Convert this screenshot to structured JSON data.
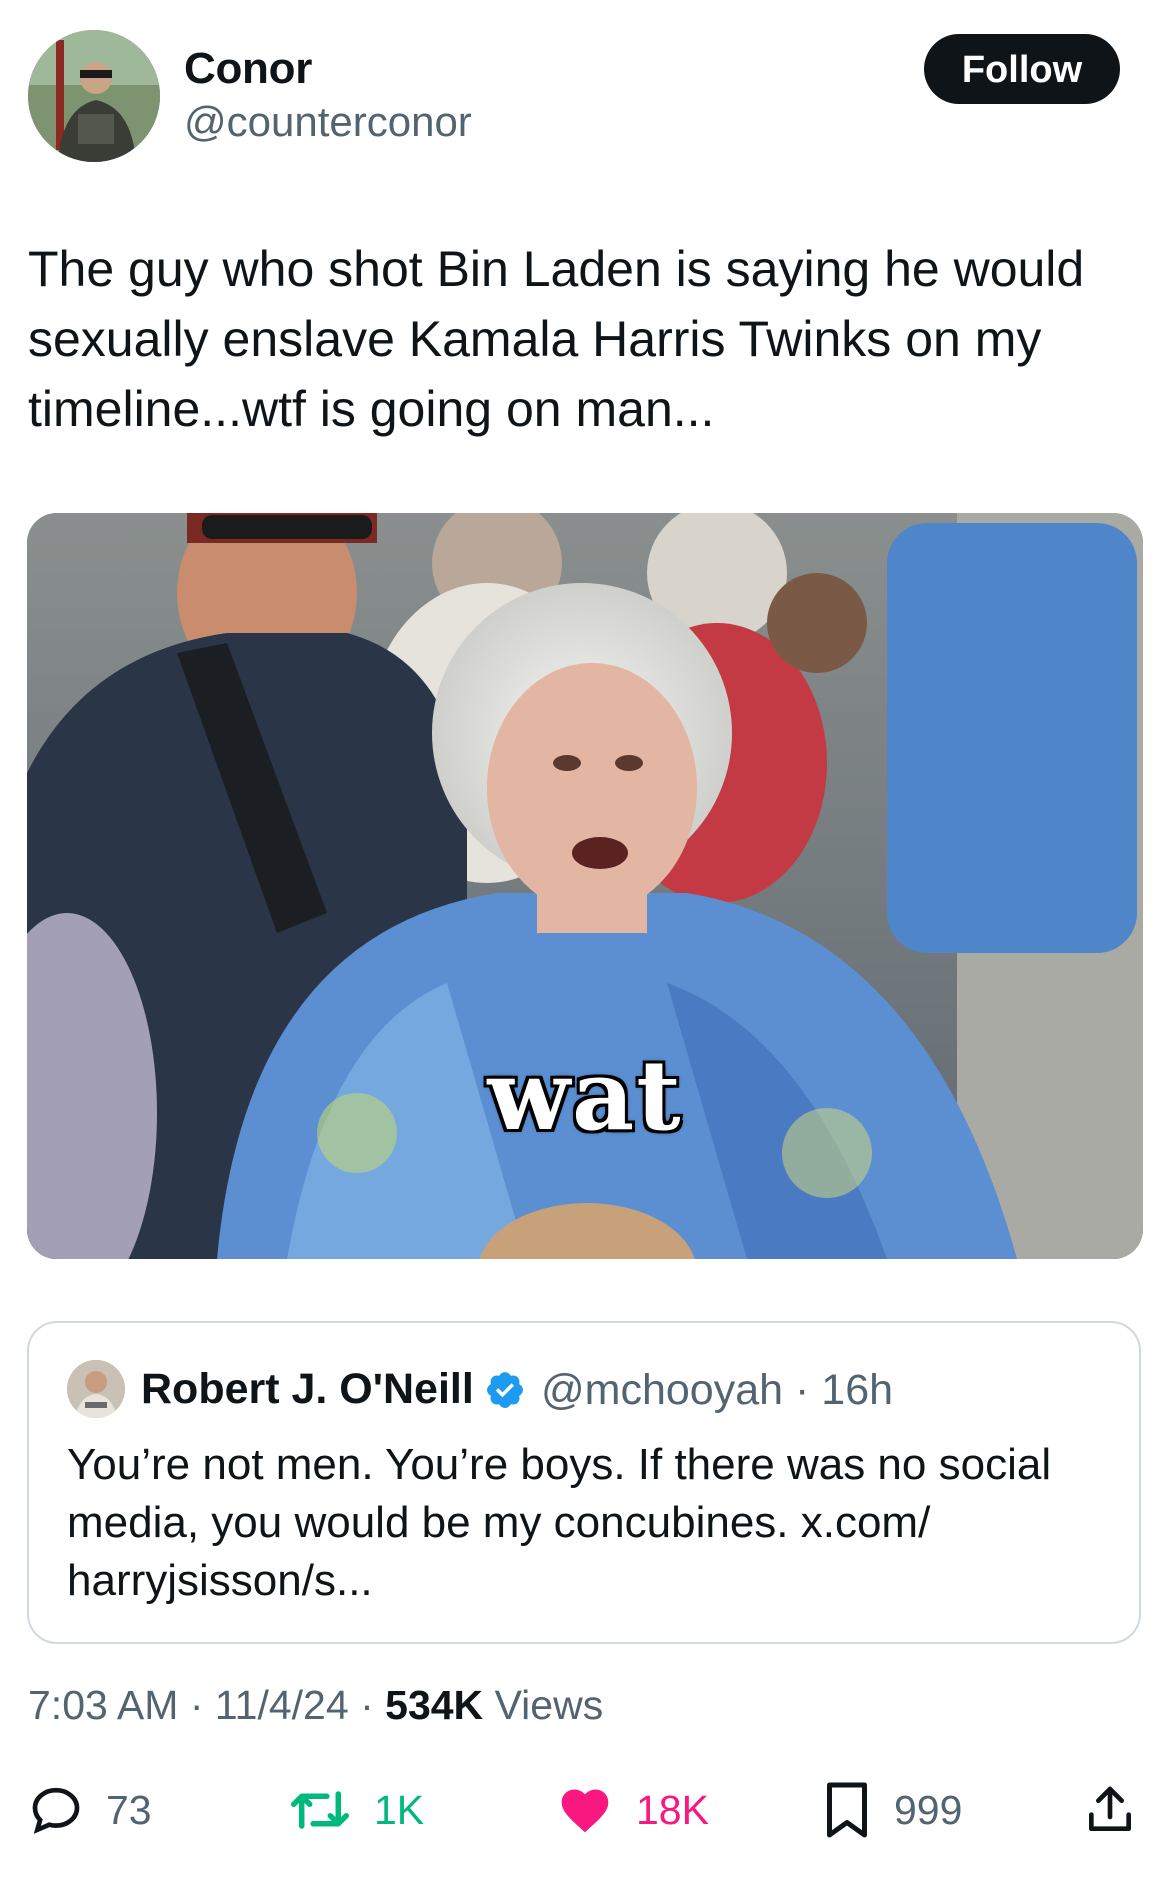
{
  "author": {
    "name": "Conor",
    "handle": "@counterconor",
    "follow_label": "Follow"
  },
  "tweet": {
    "text": "The guy who shot Bin Laden is saying he would sexually enslave Kamala Harris Twinks on my timeline...wtf is going on man..."
  },
  "media": {
    "caption": "wat",
    "icon": "photo"
  },
  "quote": {
    "name": "Robert J. O'Neill",
    "verified_icon": "verified-badge-icon",
    "handle": "@mchooyah",
    "sep": "·",
    "time": "16h",
    "text": "You’re not men. You’re boys. If there was no social media, you would be my concubines. x.com/ harryjsisson/s..."
  },
  "meta": {
    "time": "7:03 AM",
    "sep1": "·",
    "date": "11/4/24",
    "sep2": "·",
    "views_count": "534K",
    "views_label": "Views"
  },
  "actions": {
    "replies": "73",
    "reposts": "1K",
    "likes": "18K",
    "bookmarks": "999"
  },
  "colors": {
    "text": "#0f1419",
    "secondary": "#536471",
    "verified": "#1d9bf0",
    "repost": "#00ba7c",
    "like": "#f91880",
    "border": "#cfd9de"
  }
}
